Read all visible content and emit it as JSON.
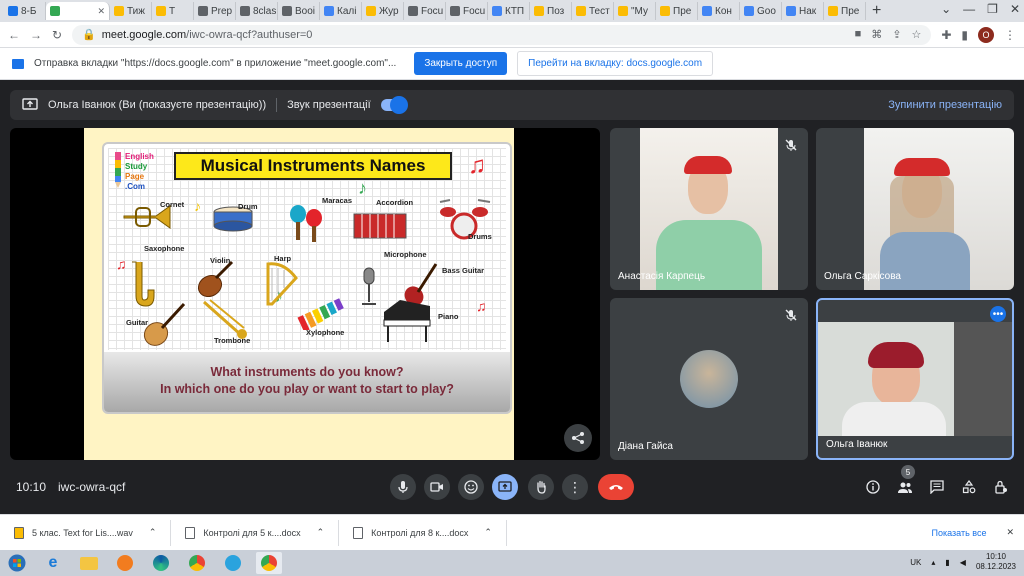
{
  "tabs": [
    {
      "label": "8-Б",
      "color": "#1a73e8"
    },
    {
      "label": "",
      "color": "#34a853",
      "active": true
    },
    {
      "label": "Тиж",
      "color": "#fbbc04"
    },
    {
      "label": "T",
      "color": "#fbbc04"
    },
    {
      "label": "Prep",
      "color": "#5f6368"
    },
    {
      "label": "8clas",
      "color": "#5f6368"
    },
    {
      "label": "Booi",
      "color": "#5f6368"
    },
    {
      "label": "Калі",
      "color": "#4285f4"
    },
    {
      "label": "Жур",
      "color": "#fbbc04"
    },
    {
      "label": "Focu",
      "color": "#5f6368"
    },
    {
      "label": "Focu",
      "color": "#5f6368"
    },
    {
      "label": "КТП",
      "color": "#4285f4"
    },
    {
      "label": "Поз",
      "color": "#fbbc04"
    },
    {
      "label": "Тест",
      "color": "#fbbc04"
    },
    {
      "label": "\"Му",
      "color": "#fbbc04"
    },
    {
      "label": "Пре",
      "color": "#fbbc04"
    },
    {
      "label": "Кон",
      "color": "#4285f4"
    },
    {
      "label": "Goo",
      "color": "#4285f4"
    },
    {
      "label": "Нак",
      "color": "#4285f4"
    },
    {
      "label": "Пре",
      "color": "#fbbc04"
    }
  ],
  "browser": {
    "url_host": "meet.google.com",
    "url_path": "/iwc-owra-qcf?authuser=0",
    "avatar_letter": "O"
  },
  "castbar": {
    "message": "Отправка вкладки \"https://docs.google.com\" в приложение \"meet.google.com\"...",
    "allow_label": "Закрыть доступ",
    "goto_label": "Перейти на вкладку: docs.google.com"
  },
  "presenting": {
    "label": "Ольга Іванюк (Ви (показуєте презентацію))",
    "sound_label": "Звук презентації",
    "stop_label": "Зупинити презентацію"
  },
  "slide": {
    "logo": [
      "English",
      "Study",
      "Page",
      ".Com"
    ],
    "title": "Musical Instruments Names",
    "labels": [
      "Cornet",
      "Drum",
      "Maracas",
      "Accordion",
      "Drums",
      "Saxophone",
      "Violin",
      "Harp",
      "Microphone",
      "Bass Guitar",
      "Guitar",
      "Trombone",
      "Xylophone",
      "Piano"
    ],
    "question1": "What instruments do you know?",
    "question2": "In which one do you play or want to start to play?"
  },
  "participants": [
    {
      "name": "Анастасія Карпець"
    },
    {
      "name": "Ольга Саркісова"
    },
    {
      "name": "Діана Гайса"
    },
    {
      "name": "Ольга Іванюк"
    }
  ],
  "controls": {
    "time": "10:10",
    "meeting_code": "iwc-owra-qcf",
    "people_count": "5"
  },
  "downloads": {
    "items": [
      "5 клас. Text for Lis....wav",
      "Контролі для 5 к....docx",
      "Контролі для 8 к....docx"
    ],
    "show_all": "Показать все"
  },
  "taskbar": {
    "lang": "UK",
    "time": "10:10",
    "date": "08.12.2023"
  }
}
